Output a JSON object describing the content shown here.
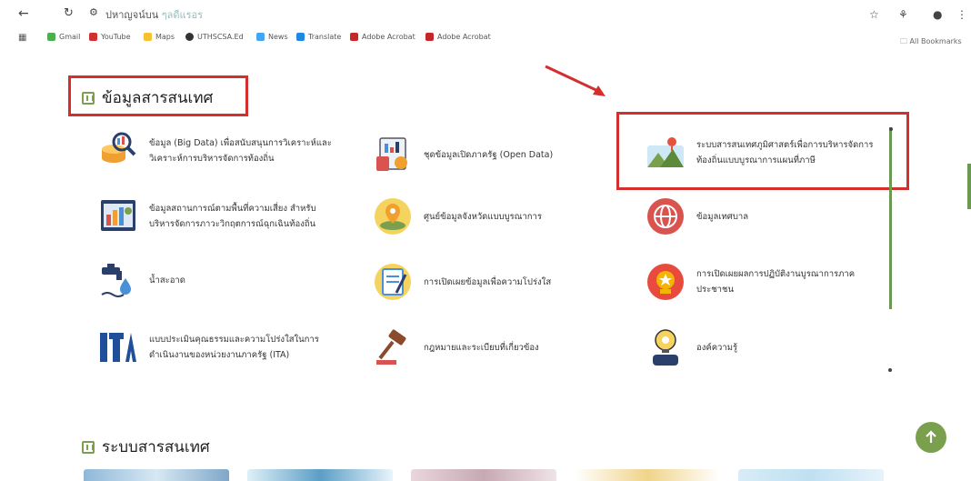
{
  "browser": {
    "address": "ปหาญจน์บน",
    "address_muted": "ๆลดีแรอร",
    "bookmarks": [
      {
        "label": "Gmail",
        "color": "#4caf50"
      },
      {
        "label": "YouTube",
        "color": "#d32f2f"
      },
      {
        "label": "Maps",
        "color": "#fbc02d"
      },
      {
        "label": "UTHSCSA.Ed",
        "color": "#333333"
      },
      {
        "label": "News",
        "color": "#42a5f5"
      },
      {
        "label": "Translate",
        "color": "#1e88e5"
      },
      {
        "label": "Adobe Acrobat",
        "color": "#c62828"
      },
      {
        "label": "Adobe Acrobat",
        "color": "#c62828"
      }
    ],
    "all_bookmarks": "All Bookmarks"
  },
  "section1": {
    "title": "ข้อมูลสารสนเทศ"
  },
  "section2": {
    "title": "ระบบสารสนเทศ"
  },
  "items": [
    {
      "label": "ข้อมูล (Big Data) เพื่อสนับสนุนการวิเคราะห์และวิเคราะห์การบริหารจัดการท้องถิ่น",
      "icon": "database-analytics-icon"
    },
    {
      "label": "ชุดข้อมูลเปิดภาครัฐ (Open Data)",
      "icon": "document-analytics-icon"
    },
    {
      "label": "ระบบสารสนเทศภูมิศาสตร์เพื่อการบริหารจัดการท้องถิ่นแบบบูรณาการแผนที่ภาษี",
      "icon": "landscape-map-icon"
    },
    {
      "label": "ข้อมูลสถานการณ์ตามพื้นที่ความเสี่ยง สำหรับบริหารจัดการภาวะวิกฤตการณ์ฉุกเฉินท้องถิ่น",
      "icon": "dashboard-report-icon"
    },
    {
      "label": "ศูนย์ข้อมูลจังหวัดแบบบูรณาการ",
      "icon": "map-pin-icon"
    },
    {
      "label": "ข้อมูลเทศบาล",
      "icon": "globe-icon"
    },
    {
      "label": "น้ำสะอาด",
      "icon": "water-tap-icon"
    },
    {
      "label": "การเปิดเผยข้อมูลเพื่อความโปร่งใส",
      "icon": "notepad-icon"
    },
    {
      "label": "การเปิดเผยผลการปฏิบัติงานบูรณาการภาคประชาชน",
      "icon": "medal-icon"
    },
    {
      "label": "แบบประเมินคุณธรรมและความโปร่งใสในการดำเนินงานของหน่วยงานภาครัฐ (ITA)",
      "icon": "ita-logo-icon"
    },
    {
      "label": "กฎหมายและระเบียบที่เกี่ยวข้อง",
      "icon": "gavel-icon"
    },
    {
      "label": "องค์ความรู้",
      "icon": "lightbulb-person-icon"
    }
  ]
}
